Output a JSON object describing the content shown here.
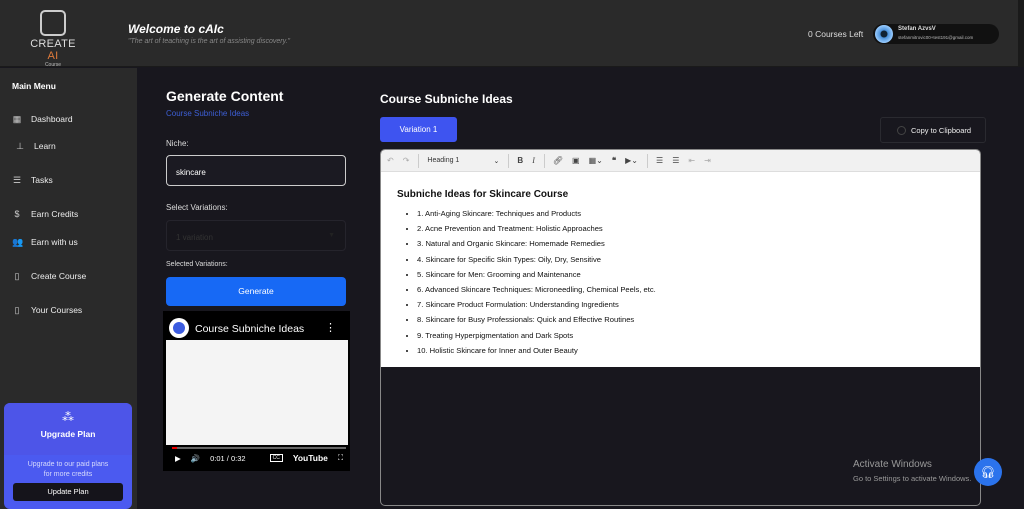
{
  "header": {
    "logo_text": "CREATE",
    "logo_accent": "AI",
    "logo_sub": "Course",
    "welcome": "Welcome to cAIc",
    "quote": "\"The art of teaching is the art of assisting discovery.\"",
    "courses_left": "0 Courses Left",
    "user_name": "Stefan AzvsV",
    "user_email": "stefanmitrovic00+test191@gmail.com"
  },
  "sidebar": {
    "title": "Main Menu",
    "items": [
      {
        "label": "Dashboard",
        "icon": "grid-icon"
      },
      {
        "label": "Learn",
        "icon": "learn-icon"
      },
      {
        "label": "Tasks",
        "icon": "list-icon"
      },
      {
        "label": "Earn Credits",
        "icon": "dollar-icon"
      },
      {
        "label": "Earn with us",
        "icon": "users-icon"
      },
      {
        "label": "Create Course",
        "icon": "book-icon"
      },
      {
        "label": "Your Courses",
        "icon": "book-icon"
      }
    ],
    "upgrade": {
      "title": "Upgrade Plan",
      "desc1": "Upgrade to our paid plans",
      "desc2": "for more credits",
      "button": "Update Plan"
    }
  },
  "form": {
    "title": "Generate Content",
    "subtitle": "Course Subniche Ideas",
    "niche_label": "Niche:",
    "niche_value": "skincare",
    "variations_label": "Select Variations:",
    "variations_value": "1 variation",
    "selected_label": "Selected Variations:",
    "generate": "Generate"
  },
  "video": {
    "title": "Course Subniche Ideas",
    "time": "0:01 / 0:32",
    "brand": "YouTube",
    "progress": 0.03
  },
  "result": {
    "title": "Course Subniche Ideas",
    "variation_tab": "Variation 1",
    "copy": "Copy to Clipboard",
    "heading_select": "Heading 1",
    "heading": "Subniche Ideas for Skincare Course",
    "items": [
      "1. Anti-Aging Skincare: Techniques and Products",
      "2. Acne Prevention and Treatment: Holistic Approaches",
      "3. Natural and Organic Skincare: Homemade Remedies",
      "4. Skincare for Specific Skin Types: Oily, Dry, Sensitive",
      "5. Skincare for Men: Grooming and Maintenance",
      "6. Advanced Skincare Techniques: Microneedling, Chemical Peels, etc.",
      "7. Skincare Product Formulation: Understanding Ingredients",
      "8. Skincare for Busy Professionals: Quick and Effective Routines",
      "9. Treating Hyperpigmentation and Dark Spots",
      "10. Holistic Skincare for Inner and Outer Beauty"
    ]
  },
  "watermark": {
    "line1": "Activate Windows",
    "line2": "Go to Settings to activate Windows."
  }
}
